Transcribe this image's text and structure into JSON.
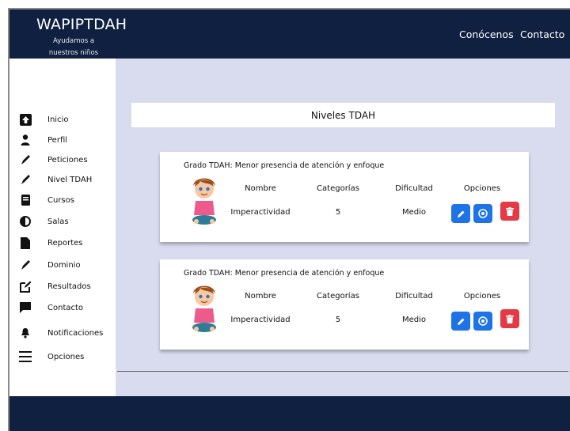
{
  "header": {
    "brand": "WAPIPTDAH",
    "tagline": "Ayudamos a nuestros niños",
    "nav": [
      {
        "label": "Conócenos"
      },
      {
        "label": "Contacto"
      }
    ]
  },
  "sidebar": {
    "items": [
      {
        "label": "Inicio",
        "icon": "home-icon"
      },
      {
        "label": "Perfil",
        "icon": "user-icon"
      },
      {
        "label": "Peticiones",
        "icon": "pen-icon"
      },
      {
        "label": "Nivel TDAH",
        "icon": "pen-icon"
      },
      {
        "label": "Cursos",
        "icon": "book-icon"
      },
      {
        "label": "Salas",
        "icon": "half-circle-icon"
      },
      {
        "label": "Reportes",
        "icon": "file-icon"
      },
      {
        "label": "Dominio",
        "icon": "pen-icon"
      },
      {
        "label": "Resultados",
        "icon": "edit-square-icon"
      },
      {
        "label": "Contacto",
        "icon": "chat-icon"
      },
      {
        "label": "Notificaciones",
        "icon": "bell-icon"
      },
      {
        "label": "Opciones",
        "icon": "menu-icon"
      }
    ]
  },
  "main": {
    "title": "Niveles TDAH",
    "cards": [
      {
        "heading": "Grado TDAH: Menor presencia de atención y enfoque",
        "headers": [
          "Nombre",
          "Categorías",
          "Dificultad",
          "Opciones"
        ],
        "values": [
          "Imperactividad",
          "5",
          "Medio"
        ]
      },
      {
        "heading": "Grado TDAH: Menor presencia de atención y enfoque",
        "headers": [
          "Nombre",
          "Categorías",
          "Dificultad",
          "Opciones"
        ],
        "values": [
          "Imperactividad",
          "5",
          "Medio"
        ]
      }
    ]
  },
  "colors": {
    "navy": "#0f2040",
    "background": "#d9dbef",
    "primary": "#1e74e6",
    "danger": "#e43a48"
  }
}
